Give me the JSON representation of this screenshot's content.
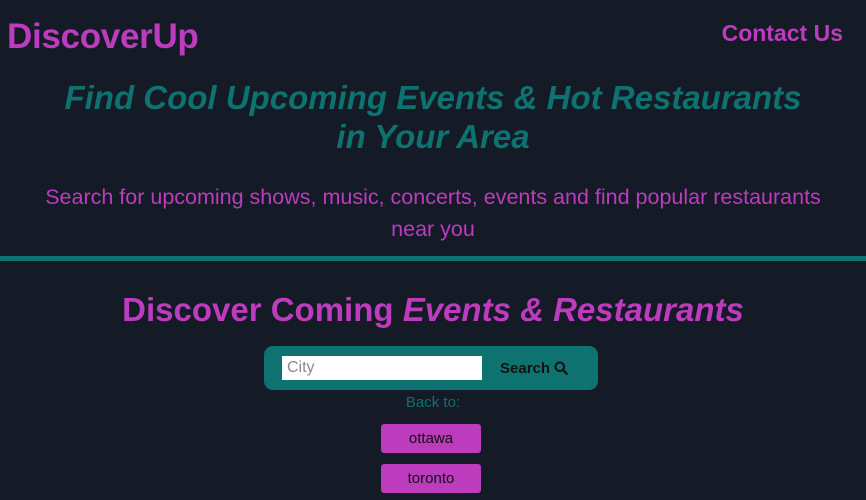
{
  "header": {
    "logo": "DiscoverUp",
    "contact": "Contact Us"
  },
  "hero": {
    "title_line1": "Find Cool Upcoming Events & Hot Restaurants",
    "title_line2": "in Your Area",
    "subtitle_line1": "Search for upcoming shows, music, concerts, events and find popular restaurants",
    "subtitle_line2": "near you"
  },
  "section": {
    "title_plain": "Discover Coming ",
    "title_italic": "Events & Restaurants"
  },
  "search": {
    "placeholder": "City",
    "value": "",
    "button_label": "Search",
    "icon": "search-icon"
  },
  "history": {
    "label": "Back to:",
    "cities": [
      "ottawa",
      "toronto"
    ]
  },
  "colors": {
    "background": "#141a26",
    "magenta": "#bd3bbd",
    "teal": "#0d7270"
  }
}
